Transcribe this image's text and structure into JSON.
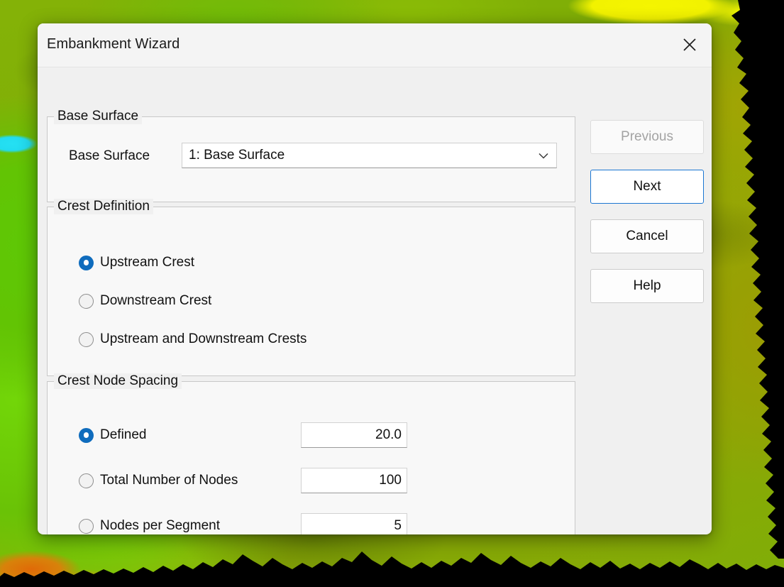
{
  "window": {
    "title": "Embankment Wizard",
    "close_icon": "close-icon"
  },
  "groups": {
    "base_surface": {
      "title": "Base Surface",
      "field_label": "Base Surface",
      "combobox": {
        "value": "1: Base Surface",
        "arrow_icon": "chevron-down-icon"
      }
    },
    "crest_definition": {
      "title": "Crest Definition",
      "options": [
        {
          "label": "Upstream Crest",
          "selected": true
        },
        {
          "label": "Downstream Crest",
          "selected": false
        },
        {
          "label": "Upstream and Downstream Crests",
          "selected": false
        }
      ]
    },
    "crest_node_spacing": {
      "title": "Crest Node Spacing",
      "options": [
        {
          "label": "Defined",
          "selected": true,
          "value": "20.0"
        },
        {
          "label": "Total Number of Nodes",
          "selected": false,
          "value": "100"
        },
        {
          "label": "Nodes per Segment",
          "selected": false,
          "value": "5"
        }
      ]
    }
  },
  "buttons": {
    "previous": "Previous",
    "next": "Next",
    "cancel": "Cancel",
    "help": "Help"
  },
  "colors": {
    "accent": "#0f6cbd",
    "focus_border": "#1b76d2",
    "dialog_bg": "#f0f0f0",
    "group_bg": "#f8f8f8",
    "disabled_text": "#a3a3a3"
  }
}
